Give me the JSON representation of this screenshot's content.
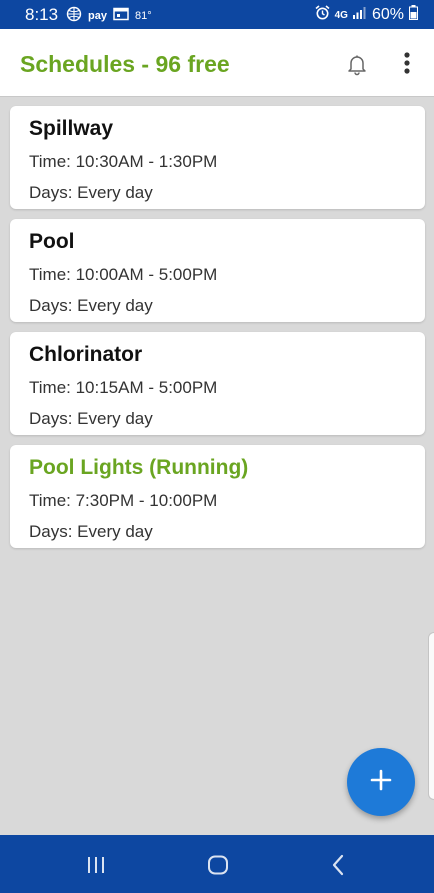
{
  "status_bar": {
    "time": "8:13",
    "pay_label": "pay",
    "temperature": "81°",
    "network": "4G",
    "battery": "60%"
  },
  "app_bar": {
    "title": "Schedules - 96 free",
    "icons": [
      "bell-icon",
      "more-vert-icon"
    ]
  },
  "schedules": [
    {
      "name": "Spillway",
      "time": "Time: 10:30AM - 1:30PM",
      "days": "Days: Every day"
    },
    {
      "name": "Pool",
      "time": "Time: 10:00AM - 5:00PM",
      "days": "Days: Every day"
    },
    {
      "name": "Chlorinator",
      "time": "Time: 10:15AM - 5:00PM",
      "days": "Days: Every day"
    },
    {
      "name": "Pool Lights (Running)",
      "time": "Time: 7:30PM - 10:00PM",
      "days": "Days: Every day"
    }
  ],
  "fab": {
    "icon": "plus-icon"
  },
  "colors": {
    "accent_green": "#6aa521",
    "status_blue": "#0d47a1",
    "fab_blue": "#1e7ad8",
    "background": "#d9d9d9"
  }
}
